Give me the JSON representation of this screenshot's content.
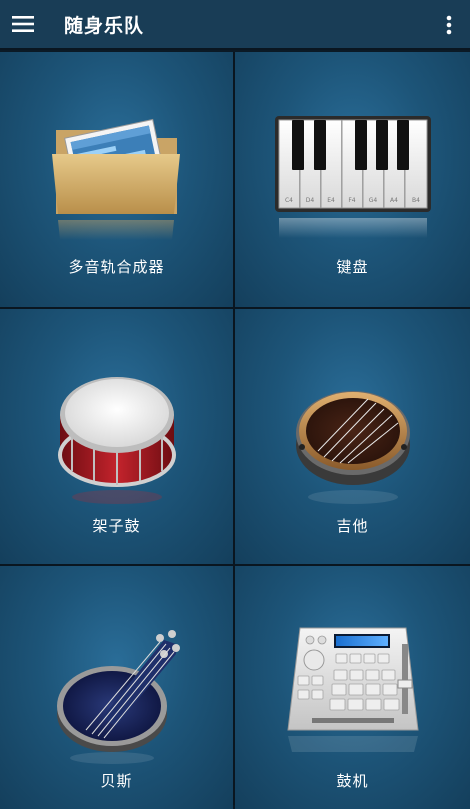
{
  "appbar": {
    "title": "随身乐队",
    "menu_icon": "hamburger-menu-icon",
    "overflow_icon": "more-vertical-icon"
  },
  "instruments": [
    {
      "label": "多音轨合成器",
      "icon": "multitrack-folder-icon"
    },
    {
      "label": "键盘",
      "icon": "piano-keyboard-icon"
    },
    {
      "label": "架子鼓",
      "icon": "snare-drum-icon"
    },
    {
      "label": "吉他",
      "icon": "guitar-icon"
    },
    {
      "label": "贝斯",
      "icon": "bass-guitar-icon"
    },
    {
      "label": "鼓机",
      "icon": "drum-machine-icon"
    }
  ],
  "keyboard_key_labels": [
    "C4",
    "D4",
    "E4",
    "F4",
    "G4",
    "A4",
    "B4"
  ],
  "colors": {
    "appbar": "#193d56",
    "tile_center": "#2a6d98",
    "tile_edge": "#143f5c",
    "divider": "#0a1620"
  }
}
